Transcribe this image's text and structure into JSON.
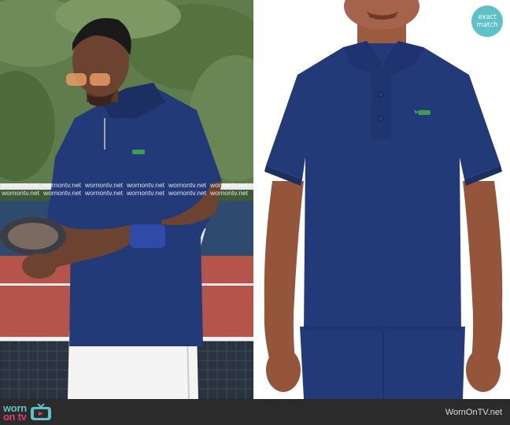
{
  "badge": {
    "line1": "exact",
    "line2": "match"
  },
  "watermark": {
    "text": "wornontv.net"
  },
  "footer": {
    "logo_worn": "worn",
    "logo_ontv": "on tv",
    "site": "WornOnTV.net"
  },
  "colors": {
    "accent_teal": "#5dc1c7",
    "accent_pink": "#e13a7a",
    "footer_bg": "#2b2b2b",
    "shirt_navy": "#233a78"
  },
  "icons": {
    "tv": "tv-icon",
    "croc": "crocodile-logo-icon"
  }
}
